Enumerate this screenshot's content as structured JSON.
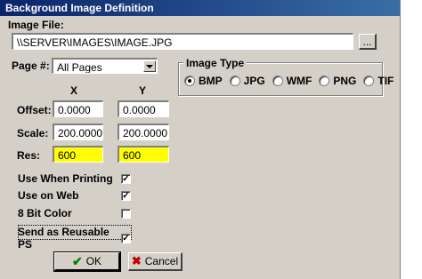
{
  "window": {
    "title": "Background Image Definition"
  },
  "image_file": {
    "label": "Image File:",
    "value": "\\\\SERVER\\IMAGES\\IMAGE.JPG",
    "browse_label": "..."
  },
  "page": {
    "label": "Page #:",
    "selected": "All Pages"
  },
  "image_type": {
    "title": "Image Type",
    "options": [
      {
        "label": "BMP",
        "selected": true
      },
      {
        "label": "JPG",
        "selected": false
      },
      {
        "label": "WMF",
        "selected": false
      },
      {
        "label": "PNG",
        "selected": false
      },
      {
        "label": "TIF",
        "selected": false
      }
    ]
  },
  "grid": {
    "x_header": "X",
    "y_header": "Y",
    "offset": {
      "label": "Offset:",
      "x": "0.0000",
      "y": "0.0000"
    },
    "scale": {
      "label": "Scale:",
      "x": "200.0000",
      "y": "200.0000"
    },
    "res": {
      "label": "Res:",
      "x": "600",
      "y": "600"
    }
  },
  "options": [
    {
      "label": "Use When Printing",
      "checked": true
    },
    {
      "label": "Use on Web",
      "checked": true
    },
    {
      "label": "8 Bit Color",
      "checked": false
    },
    {
      "label": "Send as Reusable PS",
      "checked": true
    }
  ],
  "buttons": {
    "ok_label": "OK",
    "cancel_label": "Cancel"
  },
  "colors": {
    "highlight_field": "#ffff00",
    "ok_check": "#008000",
    "cancel_x": "#c00000"
  }
}
